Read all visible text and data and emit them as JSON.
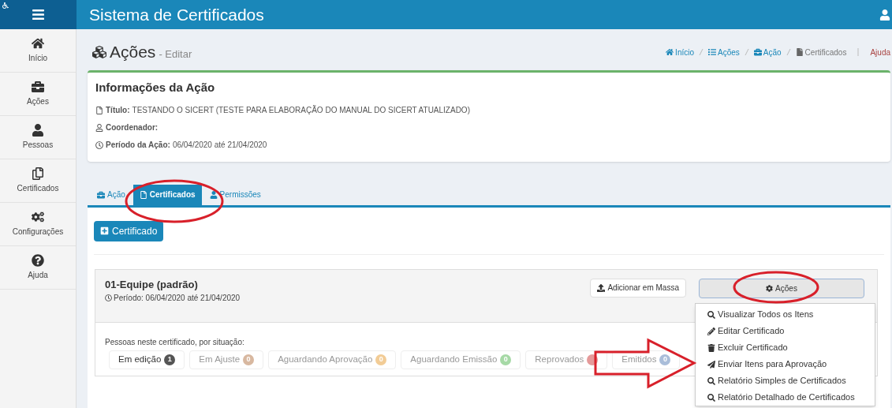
{
  "app": {
    "title": "Sistema de Certificados"
  },
  "sidebar": {
    "items": [
      {
        "label": "Início"
      },
      {
        "label": "Ações"
      },
      {
        "label": "Pessoas"
      },
      {
        "label": "Certificados"
      },
      {
        "label": "Configurações"
      },
      {
        "label": "Ajuda"
      }
    ]
  },
  "page": {
    "title": "Ações",
    "subtitle": "- Editar"
  },
  "breadcrumb": [
    {
      "label": "Início"
    },
    {
      "label": "Ações"
    },
    {
      "label": "Ação"
    },
    {
      "label": "Certificados"
    }
  ],
  "help_link": "Ajuda",
  "info_card": {
    "title": "Informações da Ação",
    "fields": [
      {
        "label": "Título:",
        "value": "TESTANDO O SICERT (TESTE PARA ELABORAÇÃO DO MANUAL DO SICERT ATUALIZADO)"
      },
      {
        "label": "Coordenador:"
      },
      {
        "label": "Período da Ação:",
        "value": "06/04/2020 até 21/04/2020"
      }
    ]
  },
  "tabs": [
    {
      "label": "Ação",
      "selected": false
    },
    {
      "label": "Certificados",
      "selected": true
    },
    {
      "label": "Permissões",
      "selected": false
    }
  ],
  "add_button": "Certificado",
  "certificate": {
    "name": "01-Equipe (padrão)",
    "period": "Período: 06/04/2020 até 21/04/2020",
    "mass_button": "Adicionar em Massa",
    "actions_button": "Ações",
    "status_caption": "Pessoas neste certificado, por situação:",
    "statuses": [
      {
        "label": "Em edição",
        "count": "1",
        "color": "#555555",
        "faded": false
      },
      {
        "label": "Em Ajuste",
        "count": "0",
        "color": "#d8b8a0",
        "faded": true
      },
      {
        "label": "Aguardando Aprovação",
        "count": "0",
        "color": "#f2cc96",
        "faded": true
      },
      {
        "label": "Aguardando Emissão",
        "count": "0",
        "color": "#a6d9a6",
        "faded": true
      },
      {
        "label": "Reprovados",
        "color": "#e59a9a",
        "faded": true
      },
      {
        "label": "Emitidos",
        "count": "0",
        "color": "#a9bdd9",
        "faded": true
      }
    ],
    "menu": [
      {
        "label": "Visualizar Todos os Itens"
      },
      {
        "label": "Editar Certificado"
      },
      {
        "label": "Excluir Certificado"
      },
      {
        "label": "Enviar Itens para Aprovação"
      },
      {
        "label": "Relatório Simples de Certificados"
      },
      {
        "label": "Relatório Detalhado de Certificados"
      }
    ]
  }
}
